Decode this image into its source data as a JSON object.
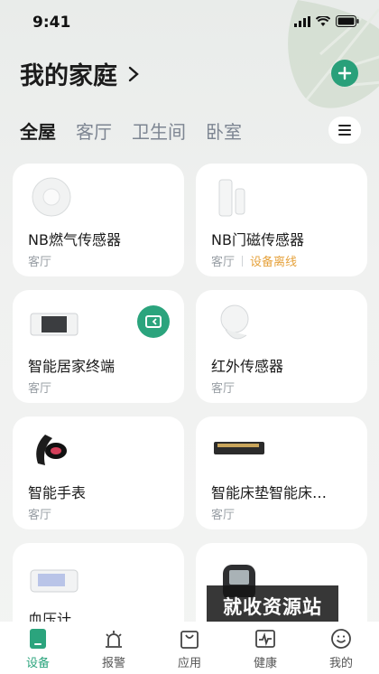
{
  "status_bar": {
    "time": "9:41"
  },
  "header": {
    "title": "我的家庭"
  },
  "tabs": [
    {
      "label": "全屋",
      "active": true
    },
    {
      "label": "客厅",
      "active": false
    },
    {
      "label": "卫生间",
      "active": false
    },
    {
      "label": "卧室",
      "active": false
    }
  ],
  "devices": [
    {
      "name": "NB燃气传感器",
      "room": "客厅",
      "status": ""
    },
    {
      "name": "NB门磁传感器",
      "room": "客厅",
      "status": "设备离线"
    },
    {
      "name": "智能居家终端",
      "room": "客厅",
      "status": ""
    },
    {
      "name": "红外传感器",
      "room": "客厅",
      "status": ""
    },
    {
      "name": "智能手表",
      "room": "客厅",
      "status": ""
    },
    {
      "name": "智能床垫智能床…",
      "room": "客厅",
      "status": ""
    },
    {
      "name": "血压计",
      "room": "",
      "status": ""
    },
    {
      "name": "",
      "room": "",
      "status": ""
    }
  ],
  "watermark": "就收资源站",
  "bottom_nav": [
    {
      "label": "设备",
      "icon": "device-icon",
      "active": true
    },
    {
      "label": "报警",
      "icon": "alarm-icon",
      "active": false
    },
    {
      "label": "应用",
      "icon": "bag-icon",
      "active": false
    },
    {
      "label": "健康",
      "icon": "health-icon",
      "active": false
    },
    {
      "label": "我的",
      "icon": "smile-icon",
      "active": false
    }
  ],
  "colors": {
    "accent": "#2ba47d",
    "offline": "#e6a23c",
    "tab_inactive": "#7d8592"
  }
}
